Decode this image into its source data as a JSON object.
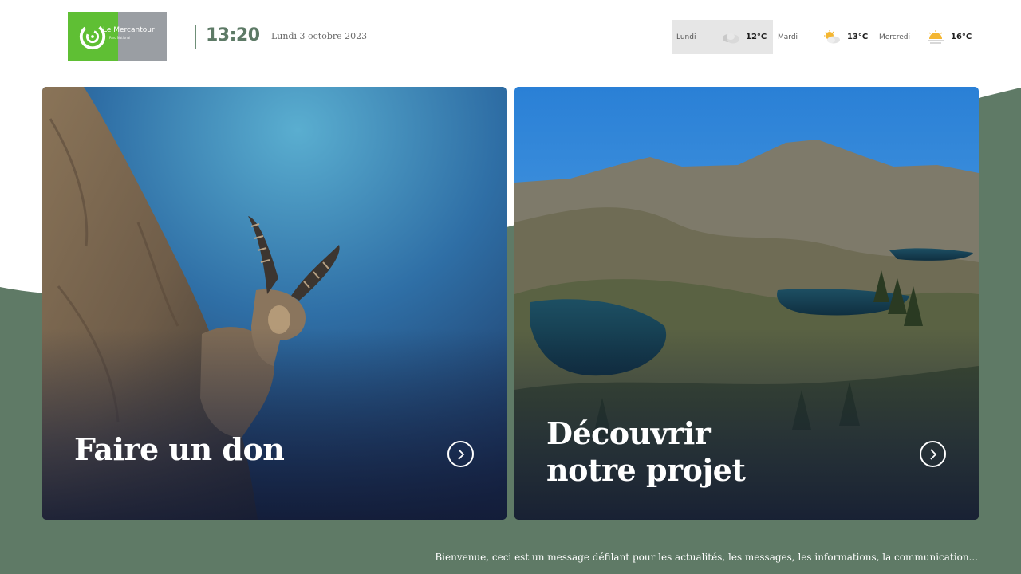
{
  "logo": {
    "name": "Le Mercantour",
    "subtitle": "Parc National"
  },
  "header": {
    "time": "13:20",
    "date": "Lundi 3 octobre 2023"
  },
  "weather": [
    {
      "day": "Lundi",
      "temp": "12°C",
      "icon": "cloud-icon"
    },
    {
      "day": "Mardi",
      "temp": "13°C",
      "icon": "sun-cloud-icon"
    },
    {
      "day": "Mercredi",
      "temp": "16°C",
      "icon": "sunset-icon"
    }
  ],
  "cards": [
    {
      "title": "Faire un don",
      "action": "arrow-right-icon"
    },
    {
      "title": "Découvrir\nnotre projet",
      "action": "arrow-right-icon"
    }
  ],
  "ticker": {
    "text": "Bienvenue, ceci est un message défilant pour les actualités, les messages, les informations, la communication..."
  },
  "colors": {
    "brand_green": "#5fbf34",
    "band_green": "#5f7a66",
    "clock_green": "#5d7a66"
  }
}
